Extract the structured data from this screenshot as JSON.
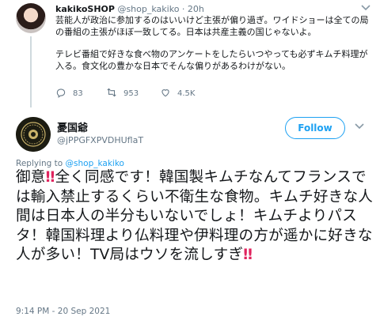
{
  "parent": {
    "name": "kakikoSHOP",
    "handle": "@shop_kakiko",
    "separator": "·",
    "time": "20h",
    "text1": "芸能人が政治に参加するのはいいけど主張が偏り過ぎ。ワイドショーは全ての局の番組の主張がほぼ一致してる。日本は共産主義の国じゃないよ。",
    "text2": "テレビ番組で好きな食べ物のアンケートをしたらいつやっても必ずキムチ料理が入る。食文化の豊かな日本でそんな偏りがあるわけがない。",
    "reply_count": "83",
    "retweet_count": "953",
    "like_count": "4.5K",
    "caret_icon": "chevron-down-icon"
  },
  "main": {
    "name": "憂国爺",
    "handle": "@jPPGFXPVDHUflaT",
    "follow_label": "Follow",
    "replying_prefix": "Replying to",
    "replying_handle": "@shop_kakiko",
    "text_before": "御意",
    "bang_glyph": "‼",
    "text_middle": "全く同感です！韓国製キムチなんてフランスでは輸入禁止するくらい不衛生な食物。キムチ好きな人間は日本人の半分もいないでしょ！キムチよりパスタ！韓国料理より仏料理や伊料理の方が遥かに好きな人が多い！TV局はウソを流しすぎ",
    "timestamp": "9:14 PM - 20 Sep 2021"
  },
  "colors": {
    "accent": "#1da1f2",
    "text": "#14171a",
    "muted": "#657786",
    "emoji_red": "#e0245e"
  }
}
